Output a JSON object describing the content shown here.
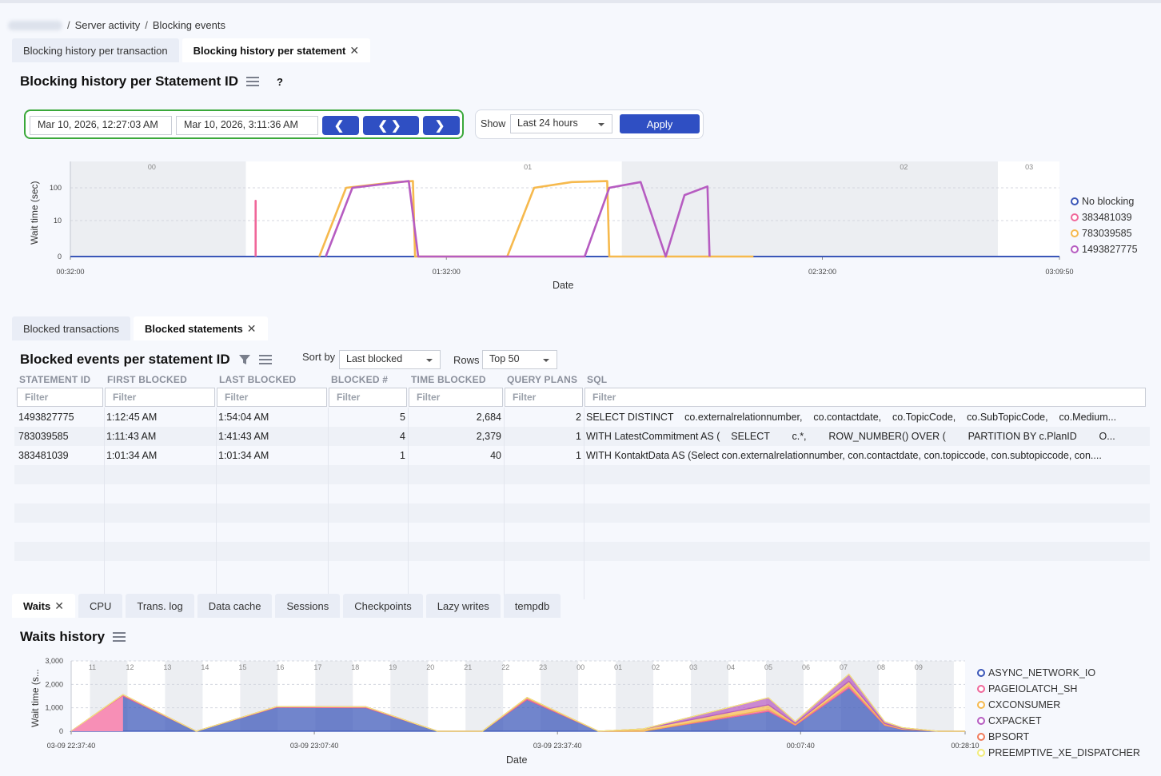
{
  "breadcrumb": [
    "Server activity",
    "Blocking events"
  ],
  "top_tabs": [
    {
      "label": "Blocking history per transaction",
      "active": false
    },
    {
      "label": "Blocking history per statement",
      "active": true
    }
  ],
  "blocking_section": {
    "title": "Blocking history per Statement ID",
    "help": "?",
    "date_from": "Mar 10, 2026, 12:27:03 AM",
    "date_to": "Mar 10, 2026, 3:11:36 AM",
    "show_label": "Show",
    "show_value": "Last 24 hours",
    "apply_label": "Apply"
  },
  "blocking_chart": {
    "type": "line",
    "ylabel": "Wait time (sec)",
    "xlabel": "Date",
    "ytick_labels": [
      "0",
      "10",
      "100"
    ],
    "xtick_labels": [
      "00:32:00",
      "01:32:00",
      "02:32:00",
      "03:09:50"
    ],
    "hour_labels": [
      "00",
      "01",
      "02",
      "03"
    ],
    "legend": [
      {
        "name": "No blocking",
        "color": "#3a56b8"
      },
      {
        "name": "383481039",
        "color": "#f0679a"
      },
      {
        "name": "783039585",
        "color": "#f6b94d"
      },
      {
        "name": "1493827775",
        "color": "#b65cc1"
      }
    ]
  },
  "chart_data": [
    {
      "type": "line",
      "xlabel": "Date",
      "ylabel": "Wait time (sec)",
      "y_scale": "log",
      "x_range": [
        "00:32:00",
        "03:09:50"
      ],
      "series": [
        {
          "name": "No blocking",
          "points": [
            [
              "00:32:00",
              0
            ],
            [
              "03:09:50",
              0
            ]
          ]
        },
        {
          "name": "383481039",
          "points": [
            [
              "01:01:34",
              0
            ],
            [
              "01:01:34",
              40
            ],
            [
              "01:01:34",
              0
            ]
          ]
        },
        {
          "name": "783039585",
          "points": [
            [
              "01:11:43",
              0
            ],
            [
              "01:16:00",
              100
            ],
            [
              "01:24:00",
              150
            ],
            [
              "01:26:40",
              160
            ],
            [
              "01:27:00",
              0
            ],
            [
              "01:41:43",
              0
            ],
            [
              "01:46:00",
              100
            ],
            [
              "01:52:00",
              150
            ],
            [
              "01:57:40",
              160
            ],
            [
              "01:58:00",
              0
            ],
            [
              "02:21:00",
              0
            ]
          ]
        },
        {
          "name": "1493827775",
          "points": [
            [
              "01:12:45",
              0
            ],
            [
              "01:17:00",
              100
            ],
            [
              "01:26:00",
              160
            ],
            [
              "01:27:30",
              0
            ],
            [
              "01:54:04",
              0
            ],
            [
              "01:58:00",
              100
            ],
            [
              "02:03:00",
              150
            ],
            [
              "02:07:00",
              0
            ],
            [
              "02:10:00",
              60
            ],
            [
              "02:13:40",
              110
            ],
            [
              "02:14:00",
              0
            ]
          ]
        }
      ]
    },
    {
      "type": "area",
      "xlabel": "Date",
      "ylabel": "Wait time (s...",
      "ylim": [
        0,
        3000
      ],
      "yticks": [
        "0",
        "1,000",
        "2,000",
        "3,000"
      ],
      "x": [
        "03-09 22:37:40",
        "03-09 22:45",
        "03-09 23:00",
        "03-09 23:05",
        "03-09 23:15",
        "03-09 23:25",
        "03-09 23:30",
        "03-09 23:35",
        "03-09 23:45",
        "03-09 23:55",
        "00:00",
        "00:05",
        "00:12",
        "00:17",
        "00:20",
        "00:25",
        "00:28:10"
      ],
      "series": [
        {
          "name": "ASYNC_NETWORK_IO",
          "values": [
            0,
            1500,
            0,
            1020,
            1000,
            0,
            0,
            1350,
            0,
            0,
            850,
            250,
            1850,
            250,
            80,
            0,
            0
          ]
        },
        {
          "name": "PAGEIOLATCH_SH",
          "values": [
            0,
            60,
            0,
            30,
            40,
            0,
            0,
            60,
            0,
            0,
            80,
            30,
            100,
            30,
            10,
            0,
            0
          ]
        },
        {
          "name": "CXCONSUMER",
          "values": [
            0,
            0,
            0,
            0,
            0,
            0,
            0,
            30,
            0,
            100,
            200,
            50,
            180,
            50,
            30,
            0,
            0
          ]
        },
        {
          "name": "CXPACKET",
          "values": [
            0,
            0,
            0,
            0,
            0,
            0,
            0,
            0,
            0,
            0,
            300,
            80,
            300,
            80,
            30,
            0,
            0
          ]
        },
        {
          "name": "BPSORT",
          "values": [
            0,
            0,
            0,
            0,
            0,
            0,
            0,
            0,
            0,
            0,
            0,
            0,
            0,
            0,
            0,
            0,
            0
          ]
        },
        {
          "name": "PREEMPTIVE_XE_DISPATCHER",
          "values": [
            0,
            0,
            0,
            0,
            0,
            0,
            0,
            0,
            0,
            0,
            0,
            0,
            0,
            0,
            0,
            0,
            0
          ]
        }
      ]
    }
  ],
  "mid_tabs": [
    {
      "label": "Blocked transactions",
      "active": false
    },
    {
      "label": "Blocked statements",
      "active": true
    }
  ],
  "blocked_section": {
    "title": "Blocked events per statement ID",
    "sort_label": "Sort by",
    "sort_value": "Last blocked",
    "rows_label": "Rows",
    "rows_value": "Top 50"
  },
  "table": {
    "columns": [
      "STATEMENT ID",
      "FIRST BLOCKED",
      "LAST BLOCKED",
      "BLOCKED #",
      "TIME BLOCKED",
      "QUERY PLANS",
      "SQL"
    ],
    "filter_placeholder": "Filter",
    "rows": [
      [
        "1493827775",
        "1:12:45 AM",
        "1:54:04 AM",
        "5",
        "2,684",
        "2",
        "SELECT DISTINCT    co.externalrelationnumber,    co.contactdate,    co.TopicCode,    co.SubTopicCode,    co.Medium..."
      ],
      [
        "783039585",
        "1:11:43 AM",
        "1:41:43 AM",
        "4",
        "2,379",
        "1",
        "WITH LatestCommitment AS (    SELECT        c.*,        ROW_NUMBER() OVER (        PARTITION BY c.PlanID        O..."
      ],
      [
        "383481039",
        "1:01:34 AM",
        "1:01:34 AM",
        "1",
        "40",
        "1",
        "WITH KontaktData AS (Select con.externalrelationnumber, con.contactdate, con.topiccode, con.subtopiccode, con...."
      ]
    ]
  },
  "bottom_tabs": [
    {
      "label": "Waits",
      "active": true
    },
    {
      "label": "CPU",
      "active": false
    },
    {
      "label": "Trans. log",
      "active": false
    },
    {
      "label": "Data cache",
      "active": false
    },
    {
      "label": "Sessions",
      "active": false
    },
    {
      "label": "Checkpoints",
      "active": false
    },
    {
      "label": "Lazy writes",
      "active": false
    },
    {
      "label": "tempdb",
      "active": false
    }
  ],
  "waits_section": {
    "title": "Waits history"
  },
  "waits_chart": {
    "ylabel": "Wait time (s...",
    "xlabel": "Date",
    "ytick_labels": [
      "0",
      "1,000",
      "2,000",
      "3,000"
    ],
    "xtick_labels": [
      "03-09 22:37:40",
      "03-09 23:07:40",
      "03-09 23:37:40",
      "00:07:40",
      "00:28:10"
    ],
    "hour_labels": [
      "11",
      "12",
      "13",
      "14",
      "15",
      "16",
      "17",
      "18",
      "19",
      "20",
      "21",
      "22",
      "23",
      "00",
      "01",
      "02",
      "03",
      "04",
      "05",
      "06",
      "07",
      "08",
      "09"
    ],
    "legend": [
      {
        "name": "ASYNC_NETWORK_IO",
        "color": "#3a56b8"
      },
      {
        "name": "PAGEIOLATCH_SH",
        "color": "#f0679a"
      },
      {
        "name": "CXCONSUMER",
        "color": "#f6b94d"
      },
      {
        "name": "CXPACKET",
        "color": "#b65cc1"
      },
      {
        "name": "BPSORT",
        "color": "#f07a5a"
      },
      {
        "name": "PREEMPTIVE_XE_DISPATCHER",
        "color": "#f2ec7a"
      }
    ]
  }
}
